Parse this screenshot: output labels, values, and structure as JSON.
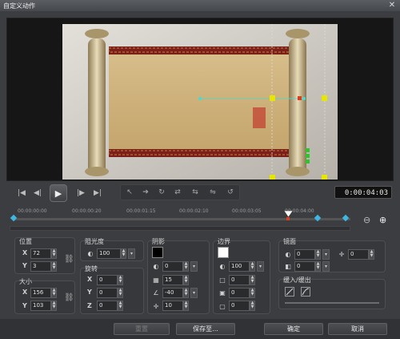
{
  "window": {
    "title": "自定义动作",
    "close_glyph": "✕"
  },
  "transport": {
    "buttons": [
      "|◀",
      "◀|",
      "▶",
      "|▶",
      "▶|"
    ],
    "timecode": "0:00:04:03"
  },
  "tools": {
    "buttons": [
      "↖",
      "➔",
      "↻",
      "⇄",
      "⇆",
      "⇋",
      "↺"
    ]
  },
  "timeline": {
    "ticks": [
      "00:00:00:00",
      "00:00:00:20",
      "00:00:01:15",
      "00:00:02:10",
      "00:00:03:05",
      "00:00:04:00"
    ],
    "zoom_out": "⊖",
    "zoom_in": "⊕"
  },
  "position": {
    "label": "位置",
    "x_label": "X",
    "x": "72",
    "y_label": "Y",
    "y": "3"
  },
  "size": {
    "label": "大小",
    "x_label": "X",
    "x": "156",
    "y_label": "Y",
    "y": "103"
  },
  "opacity": {
    "label": "阻光度",
    "value": "100"
  },
  "rotation": {
    "label": "旋转",
    "x_label": "X",
    "x": "0",
    "y_label": "Y",
    "y": "0",
    "z_label": "Z",
    "z": "0"
  },
  "shadow": {
    "label": "阴影",
    "v1": "0",
    "v2": "15",
    "v3": "-40",
    "v4": "10"
  },
  "border": {
    "label": "边界",
    "v1": "100",
    "v2": "0",
    "v3": "0",
    "v4": "0"
  },
  "mirror": {
    "label": "镜面",
    "v1": "0",
    "v2": "0",
    "v3": "0"
  },
  "fade": {
    "label": "缓入/缓出"
  },
  "footer": {
    "reset": "重置",
    "save_as": "保存至...",
    "ok": "确定",
    "cancel": "取消"
  }
}
